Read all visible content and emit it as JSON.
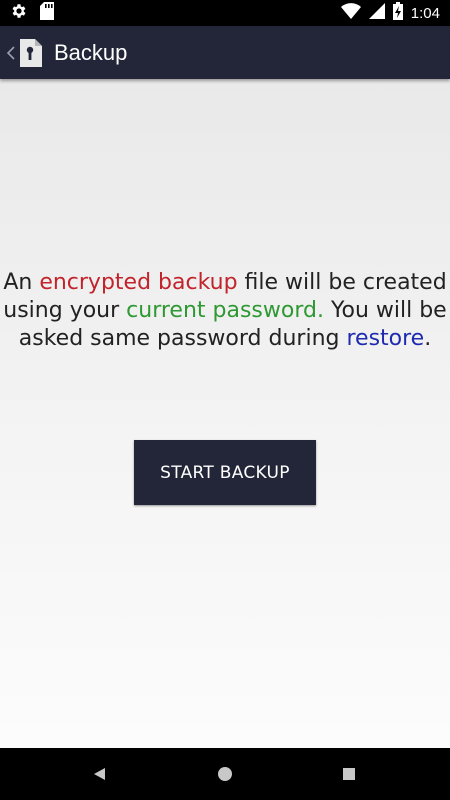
{
  "status_bar": {
    "time": "1:04",
    "icons": [
      "gear-icon",
      "sd-card-icon",
      "wifi-icon",
      "signal-icon",
      "battery-charging-icon"
    ]
  },
  "app_bar": {
    "title": "Backup",
    "back_icon": "chevron-left-icon",
    "logo_icon": "lock-file-icon"
  },
  "message": {
    "part1": "An ",
    "part2_red": "encrypted backup",
    "part3": " file will be created using your ",
    "part4_green": "current password.",
    "part5": " You will be asked same password during ",
    "part6_blue": "restore",
    "part7": "."
  },
  "button": {
    "label": "START BACKUP"
  },
  "nav_bar": {
    "icons": [
      "back-triangle-icon",
      "home-circle-icon",
      "recents-square-icon"
    ]
  },
  "colors": {
    "app_bar": "#222638",
    "button": "#222638",
    "red": "#c2242c",
    "green": "#2e9932",
    "blue": "#1e2bb0"
  }
}
